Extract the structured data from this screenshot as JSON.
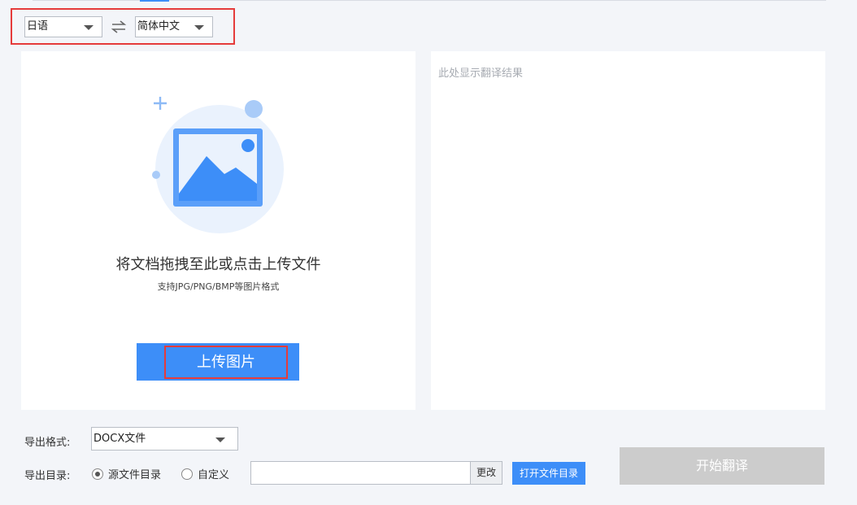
{
  "language_bar": {
    "source_language": "日语",
    "target_language": "简体中文",
    "swap_icon": "swap-arrows-icon"
  },
  "upload_panel": {
    "illustration_icon": "image-upload-icon",
    "title": "将文档拖拽至此或点击上传文件",
    "subtitle": "支持JPG/PNG/BMP等图片格式",
    "upload_button": "上传图片"
  },
  "result_panel": {
    "placeholder": "此处显示翻译结果"
  },
  "export": {
    "format_label": "导出格式:",
    "format_value": "DOCX文件",
    "directory_label": "导出目录:",
    "radio_source": "源文件目录",
    "radio_custom": "自定义",
    "selected": "source",
    "path_value": "",
    "change_button": "更改",
    "open_folder_button": "打开文件目录",
    "start_button": "开始翻译"
  },
  "colors": {
    "accent": "#3d8ef8",
    "highlight_border": "#e53b3b",
    "disabled": "#cccccc",
    "background": "#f3f5f9"
  }
}
